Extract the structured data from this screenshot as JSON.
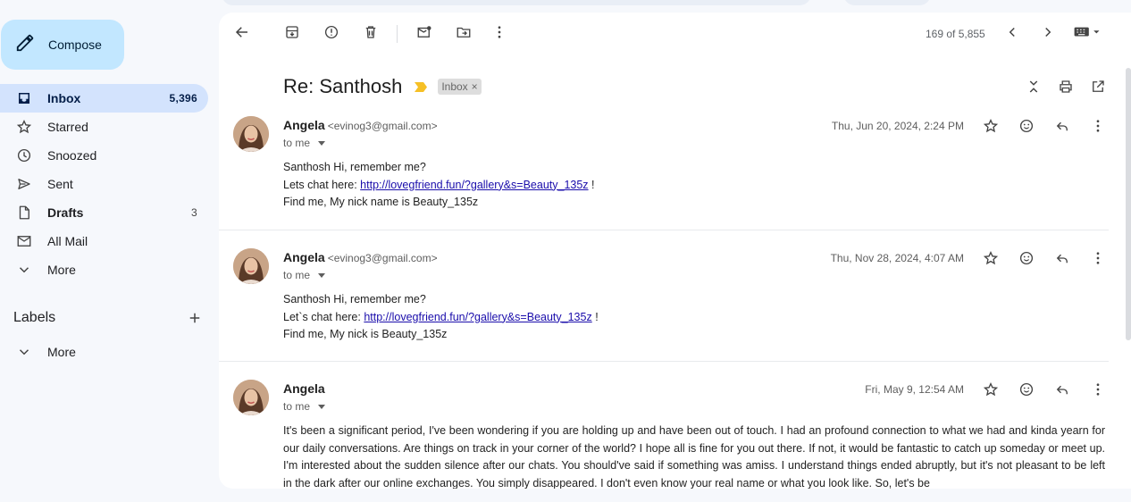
{
  "compose": {
    "label": "Compose"
  },
  "nav": {
    "items": [
      {
        "label": "Inbox",
        "count": "5,396"
      },
      {
        "label": "Starred",
        "count": ""
      },
      {
        "label": "Snoozed",
        "count": ""
      },
      {
        "label": "Sent",
        "count": ""
      },
      {
        "label": "Drafts",
        "count": "3"
      },
      {
        "label": "All Mail",
        "count": ""
      },
      {
        "label": "More",
        "count": ""
      }
    ]
  },
  "labels": {
    "title": "Labels",
    "more": "More"
  },
  "toolbar": {
    "pager": "169 of 5,855"
  },
  "thread": {
    "subject": "Re: Santhosh",
    "chip": "Inbox",
    "chip_close": "×"
  },
  "messages": [
    {
      "sender": "Angela",
      "email": "<evinog3@gmail.com>",
      "to": "to me",
      "date": "Thu, Jun 20, 2024, 2:24 PM",
      "line1": "Santhosh Hi, remember me?",
      "line2_prefix": "Lets chat here: ",
      "link": "http://lovegfriend.fun/?gallery&s=Beauty_135z",
      "line2_suffix": " !",
      "line3": "Find me, My nick name is Beauty_135z"
    },
    {
      "sender": "Angela",
      "email": "<evinog3@gmail.com>",
      "to": "to me",
      "date": "Thu, Nov 28, 2024, 4:07 AM",
      "line1": "Santhosh Hi, remember me?",
      "line2_prefix": "Let`s chat here: ",
      "link": "http://lovegfriend.fun/?gallery&s=Beauty_135z",
      "line2_suffix": " !",
      "line3": "Find me, My nick is Beauty_135z"
    },
    {
      "sender": "Angela",
      "to": "to me",
      "date": "Fri, May 9, 12:54 AM",
      "body": "It's been a significant period, I've been wondering if you are holding up and have been out of touch. I had an profound connection to what we had and kinda yearn for our daily conversations. Are things on track in your corner of the world? I hope all is fine for you out there. If not, it would be fantastic to catch up someday or meet up. I'm interested about the sudden silence after our chats. You should've said if something was amiss. I understand things ended abruptly, but it's not pleasant to be left in the dark after our online exchanges. You simply disappeared. I don't even know your real name or what you look like. So, let's be"
    }
  ],
  "colors": {
    "accent": "#0b57d0",
    "compose_bg": "#c2e7ff",
    "active_nav": "#d3e3fd",
    "marker": "#f6c026"
  }
}
